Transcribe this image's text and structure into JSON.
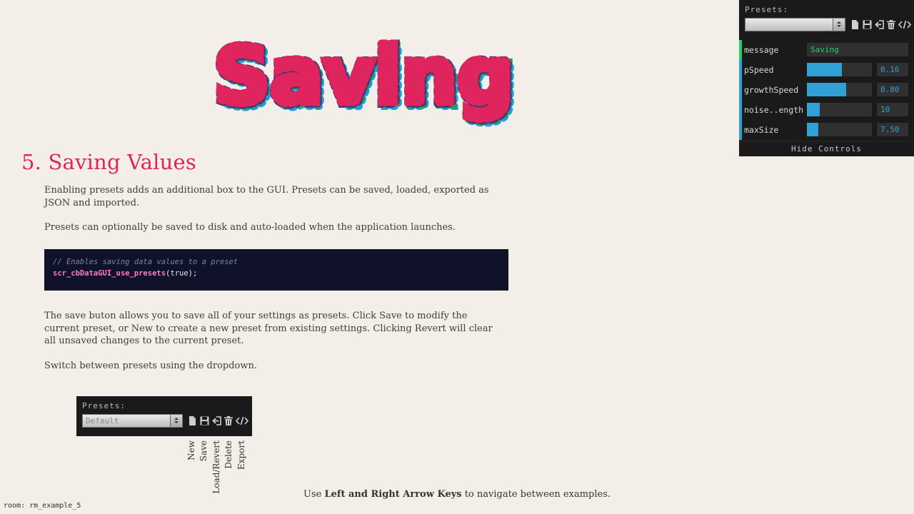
{
  "hero": {
    "text": "Saving",
    "colors": [
      "#e0245e",
      "#4a3a6e",
      "#1aa0e6",
      "#1fa34a"
    ]
  },
  "heading": "5. Saving Values",
  "paragraphs": [
    "Enabling presets adds an additional box to the GUI. Presets can be saved, loaded, exported as JSON and imported.",
    "Presets can optionally be saved to disk and auto-loaded when the application launches.",
    "The save buton allows you to save all of your settings as presets. Click Save to modify the current preset, or New to create a new preset from existing settings. Clicking Revert will clear all unsaved changes to the current preset.",
    "Switch between presets using the dropdown."
  ],
  "code": {
    "comment": "// Enables saving data values to a preset",
    "fn": "scr_cbDataGUI_use_presets",
    "args": "(true);"
  },
  "gui": {
    "presets_label": "Presets:",
    "preset_value": "",
    "icons": [
      "new-icon",
      "save-icon",
      "revert-icon",
      "delete-icon",
      "export-icon"
    ],
    "rows": [
      {
        "label": "message",
        "type": "text",
        "value": "Saving"
      },
      {
        "label": "pSpeed",
        "type": "number",
        "value": "0.16",
        "fraction": 0.54
      },
      {
        "label": "growthSpeed",
        "type": "number",
        "value": "0.80",
        "fraction": 0.6
      },
      {
        "label": "noise..ength",
        "type": "number",
        "value": "10",
        "fraction": 0.2
      },
      {
        "label": "maxSize",
        "type": "number",
        "value": "7.50",
        "fraction": 0.18
      }
    ],
    "hide_controls": "Hide Controls"
  },
  "example": {
    "presets_label": "Presets:",
    "preset_value": "Default",
    "annotations": [
      "New",
      "Save",
      "Load/Revert",
      "Delete",
      "Export"
    ]
  },
  "footer": {
    "prefix": "Use ",
    "keys": "Left and Right Arrow Keys",
    "suffix": " to navigate between examples."
  },
  "room": "room: rm_example_5",
  "colors": {
    "accent": "#e0245e",
    "gui_bg": "#1a1a1a",
    "slider": "#2fa1d6",
    "string": "#1ed36f"
  }
}
